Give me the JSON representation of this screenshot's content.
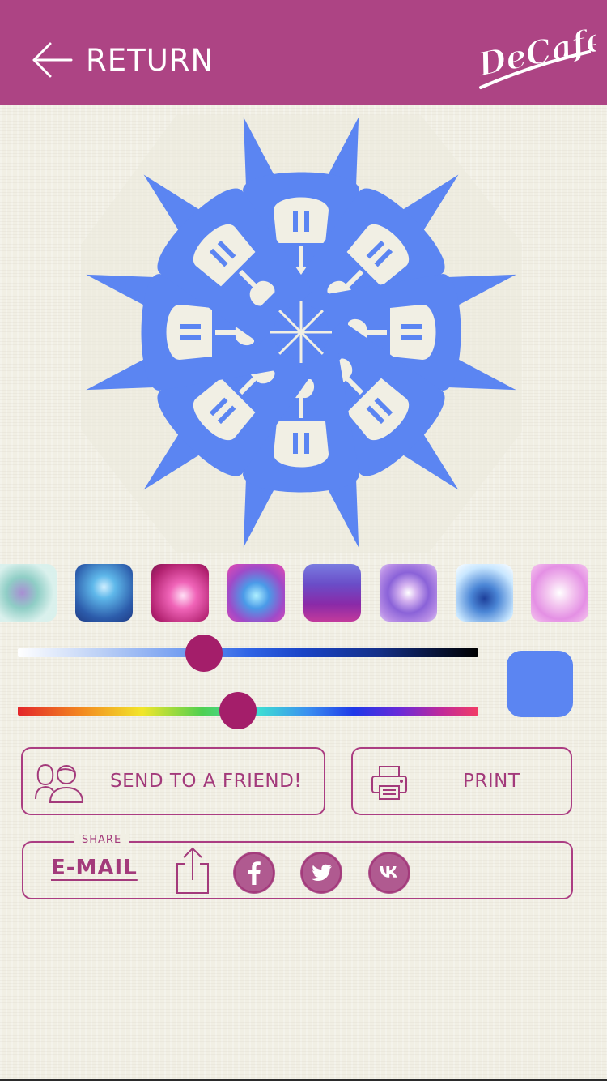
{
  "header": {
    "return_label": "RETURN",
    "logo_text": "DeCafe"
  },
  "icons": {
    "back": "arrow-left-icon",
    "send": "two-people-icon",
    "print": "printer-icon",
    "share": "share-upload-icon",
    "facebook": "facebook-icon",
    "twitter": "twitter-icon",
    "vk": "vk-icon"
  },
  "snowflake": {
    "color": "#5b85f2"
  },
  "textures": [
    "texture-1",
    "texture-2",
    "texture-3",
    "texture-4",
    "texture-5",
    "texture-6",
    "texture-7",
    "texture-8"
  ],
  "sliders": {
    "brightness_level": 0.4,
    "hue_level": 0.48
  },
  "selected_color": "#5b85f2",
  "actions": {
    "send_label": "SEND TO A FRIEND!",
    "print_label": "PRINT"
  },
  "share": {
    "title": "SHARE",
    "email_label": "E-MAIL"
  },
  "colors": {
    "accent": "#ad4484",
    "accent_dark": "#a41e6a",
    "paper": "#f1efe4"
  }
}
